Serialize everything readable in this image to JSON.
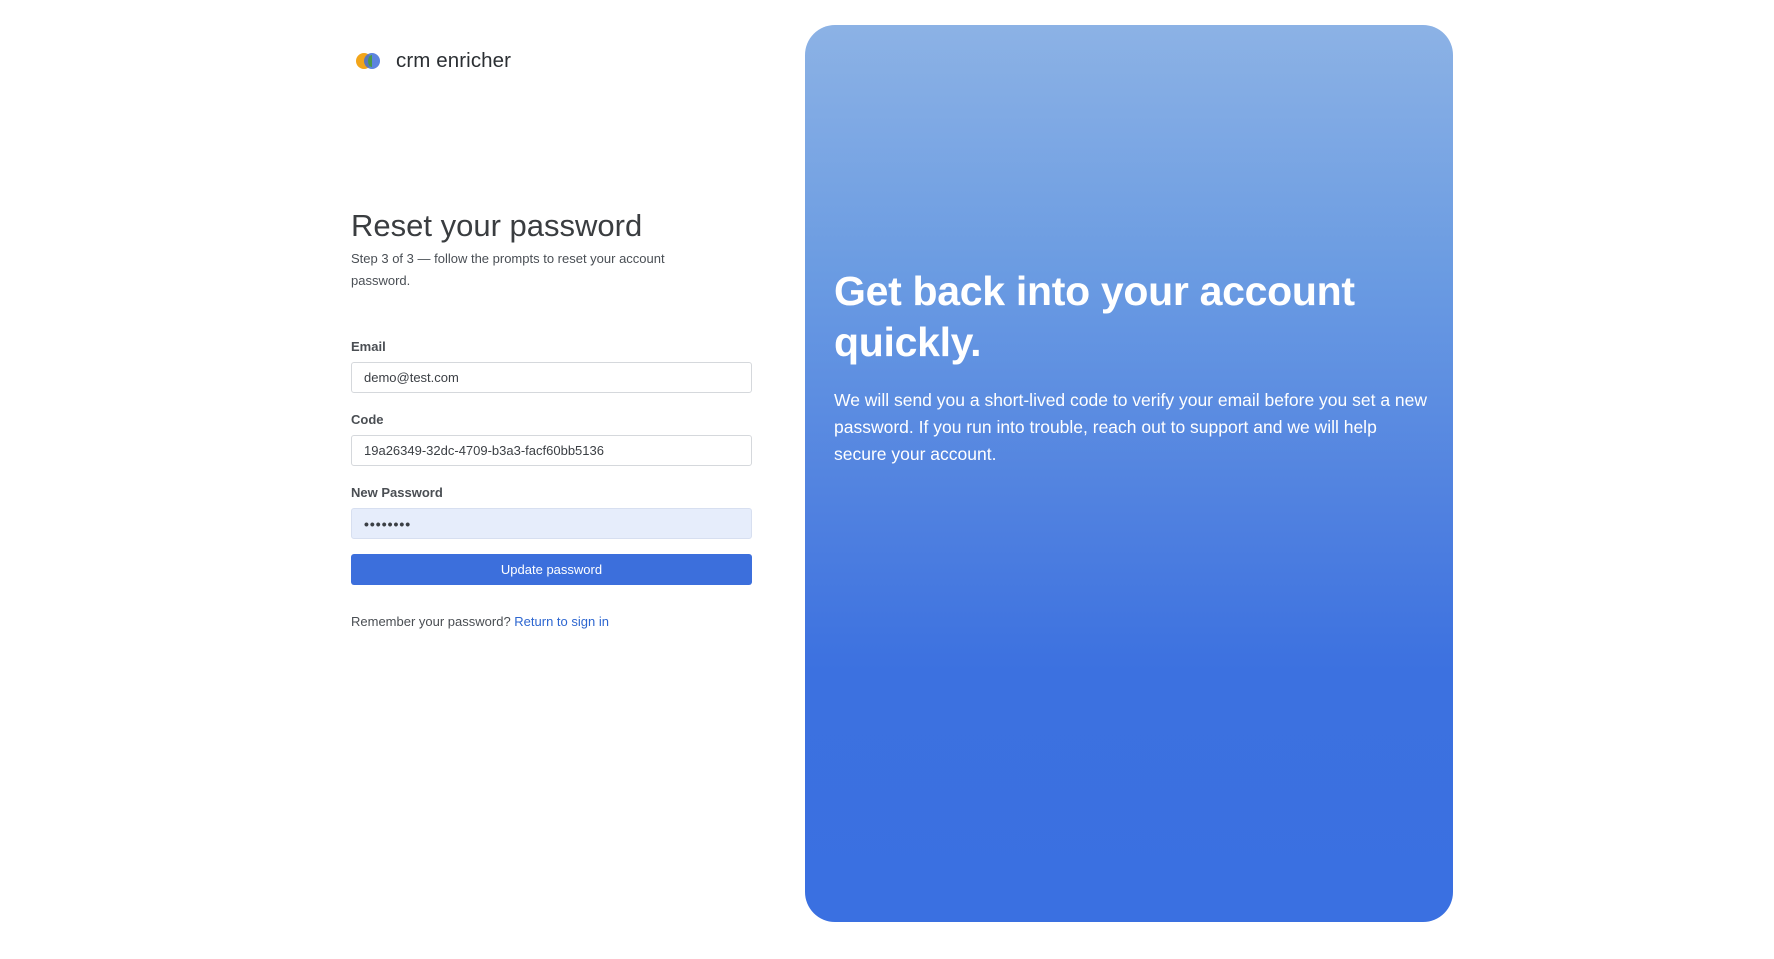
{
  "brand": {
    "name": "crm enricher"
  },
  "form": {
    "title": "Reset your password",
    "subtitle": "Step 3 of 3 — follow the prompts to reset your account password.",
    "fields": {
      "email": {
        "label": "Email",
        "value": "demo@test.com"
      },
      "code": {
        "label": "Code",
        "value": "19a26349-32dc-4709-b3a3-facf60bb5136"
      },
      "new_password": {
        "label": "New Password",
        "masked_value": "••••••••"
      }
    },
    "submit_label": "Update password",
    "footer": {
      "prompt": "Remember your password?",
      "link_label": "Return to sign in"
    }
  },
  "hero": {
    "heading": "Get back into your account quickly.",
    "body": "We will send you a short-lived code to verify your email before you set a new password. If you run into trouble, reach out to support and we will help secure your account."
  },
  "colors": {
    "accent": "#3c6fdc",
    "link": "#2d66d0",
    "hero_top": "#8cb2e5",
    "hero_bottom": "#3a70e1",
    "autofill_bg": "#e6edfb"
  },
  "icons": {
    "logo": "crm-enricher-logo-icon"
  }
}
